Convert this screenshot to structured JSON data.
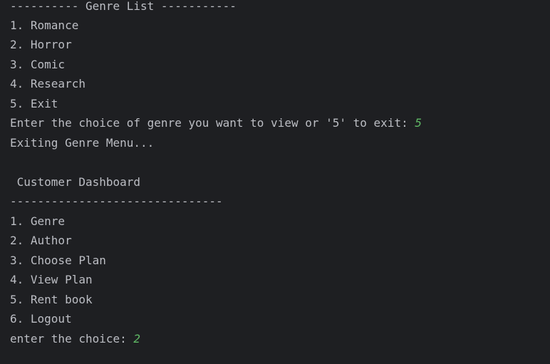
{
  "console": {
    "genre_header": "---------- Genre List -----------",
    "genre_items": [
      "1. Romance",
      "2. Horror",
      "3. Comic",
      "4. Research",
      "5. Exit"
    ],
    "genre_prompt": "Enter the choice of genre you want to view or '5' to exit: ",
    "genre_input": "5",
    "exit_message": "Exiting Genre Menu...",
    "dashboard_title": " Customer Dashboard",
    "dashboard_divider": "-------------------------------",
    "dashboard_items": [
      "1. Genre",
      "2. Author",
      "3. Choose Plan",
      "4. View Plan",
      "5. Rent book",
      "6. Logout"
    ],
    "choice_prompt": "enter the choice: ",
    "choice_input": "2",
    "colors": {
      "background": "#1e1f22",
      "text": "#bcbec4",
      "user_input": "#5fb865"
    }
  }
}
